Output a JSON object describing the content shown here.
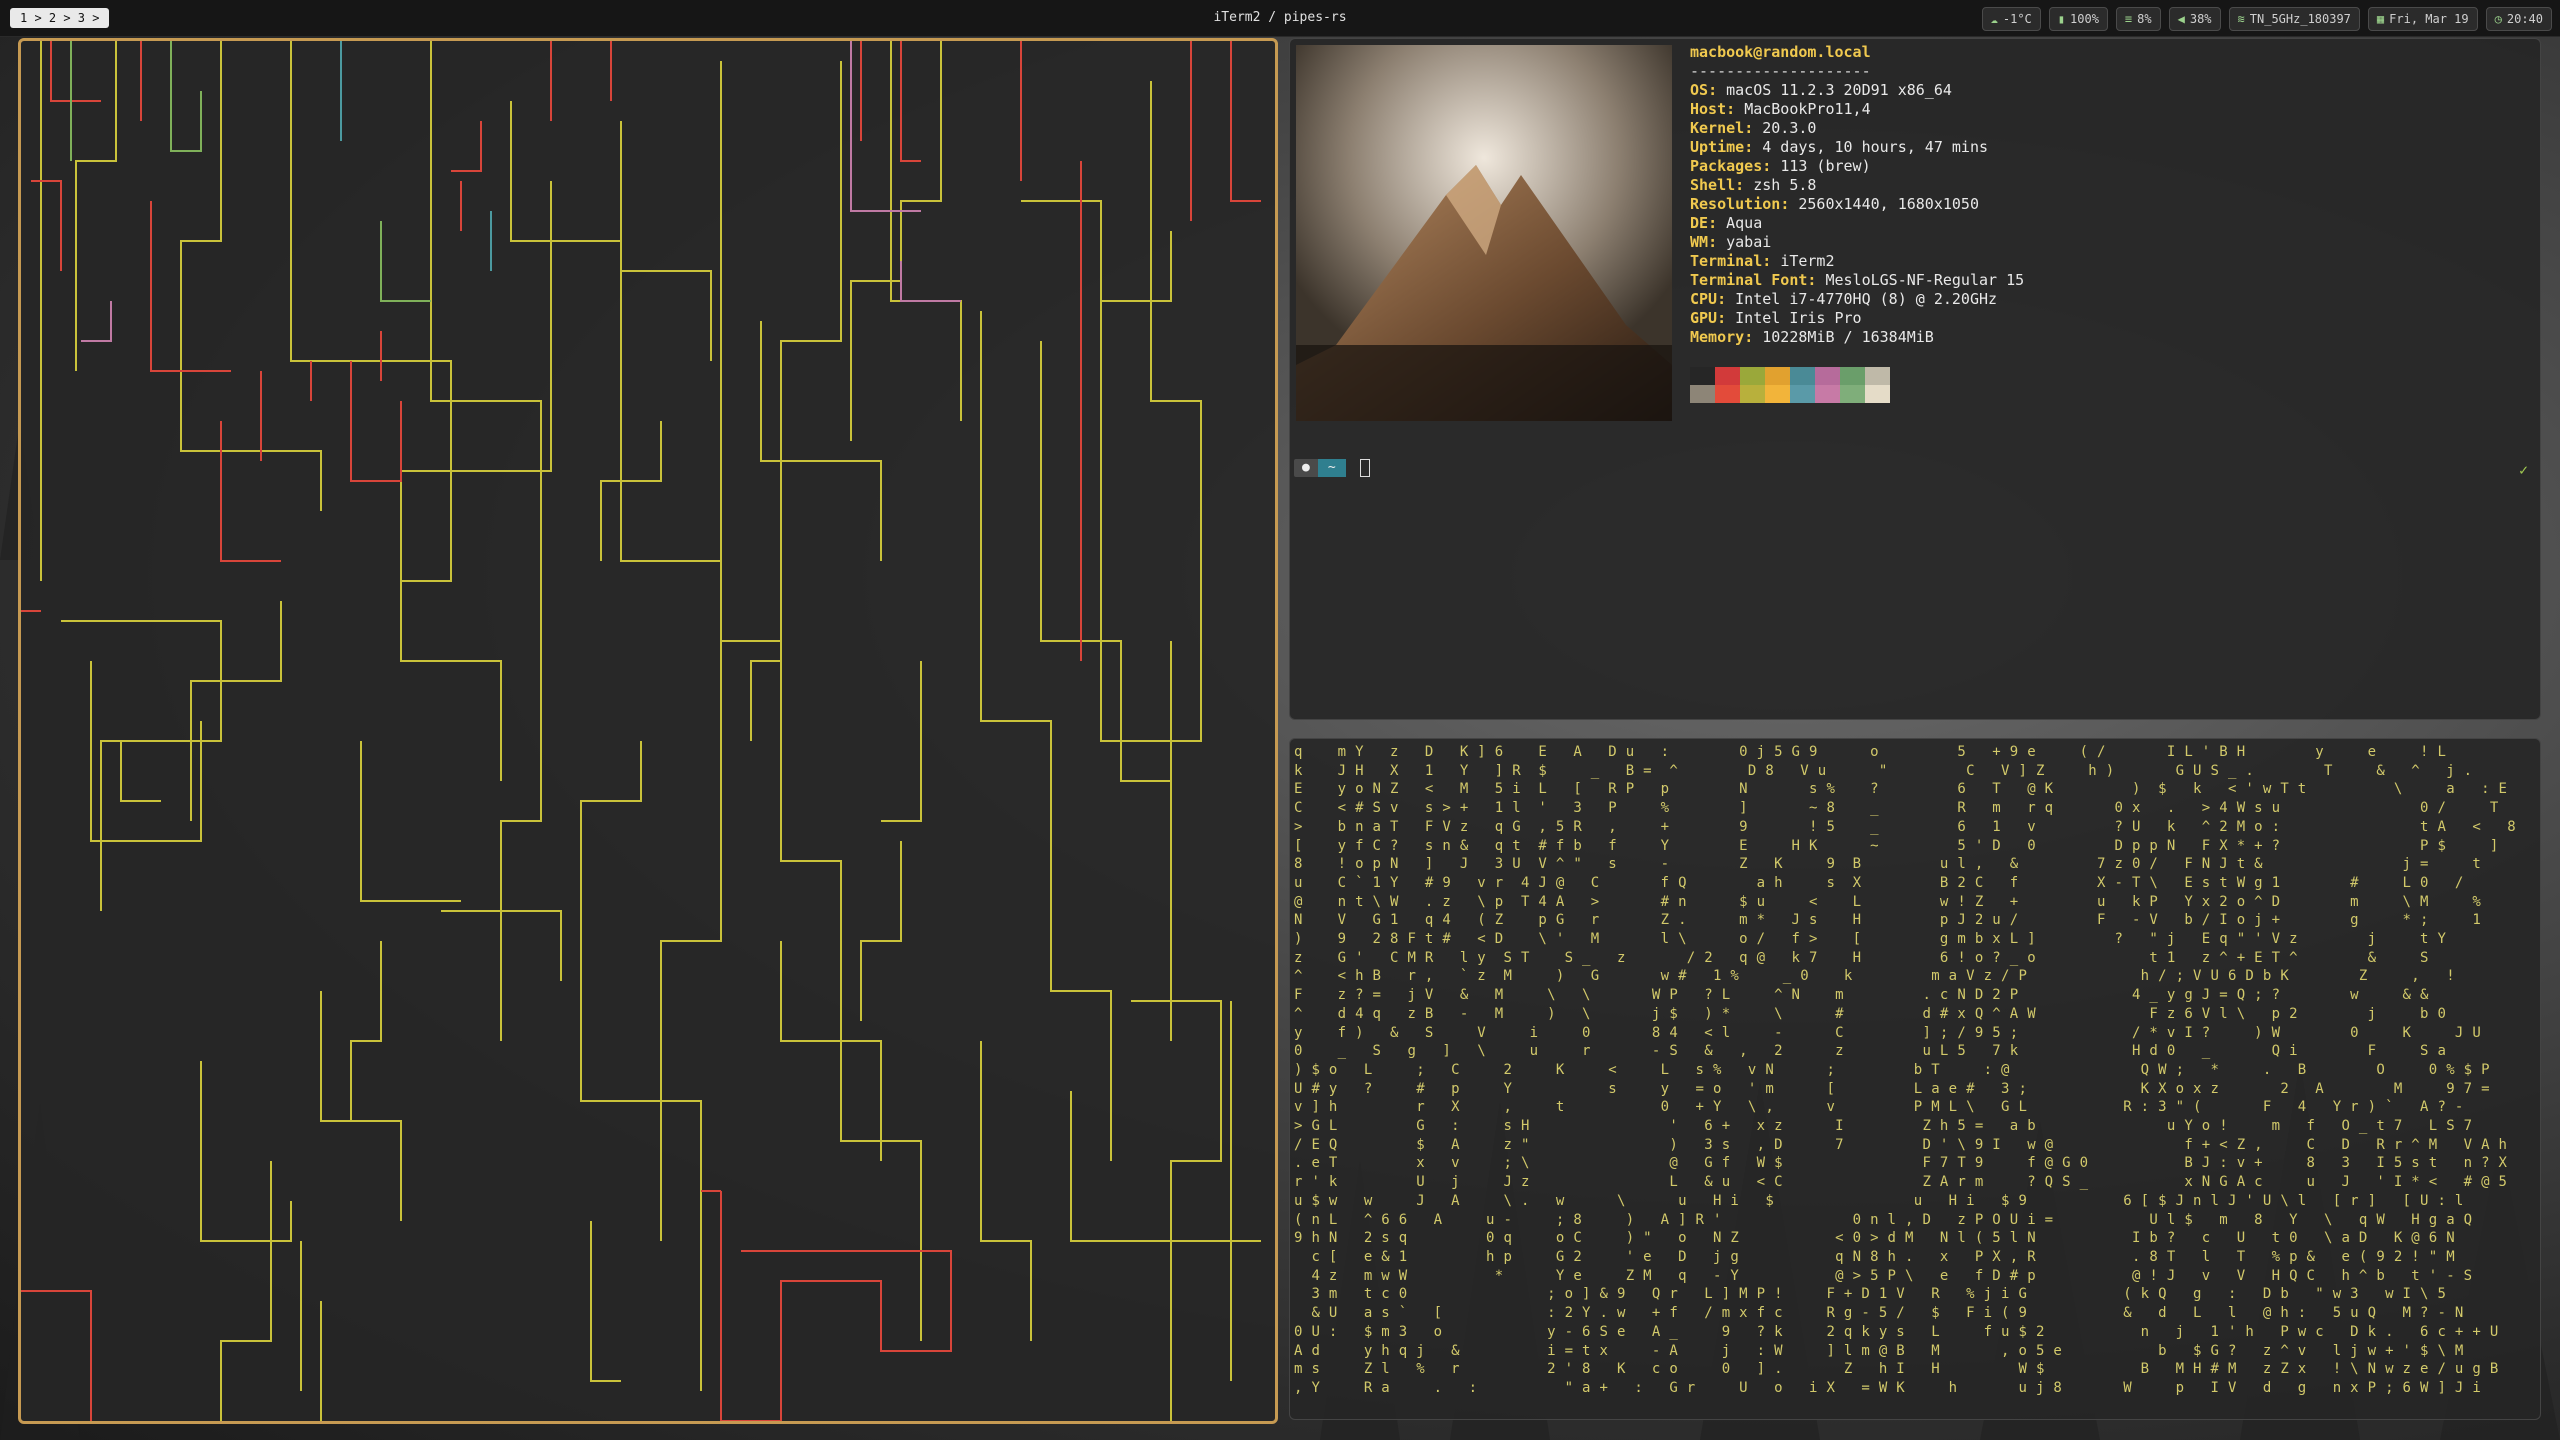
{
  "menubar": {
    "spaces_label": "1 > 2 > 3 >",
    "window_title": "iTerm2 / pipes-rs",
    "status": [
      {
        "icon": "cloud-icon",
        "label": "-1°C"
      },
      {
        "icon": "battery-icon",
        "label": "100%"
      },
      {
        "icon": "cpu-icon",
        "label": "8%"
      },
      {
        "icon": "volume-icon",
        "label": "38%"
      },
      {
        "icon": "wifi-icon",
        "label": "TN_5GHz_180397"
      },
      {
        "icon": "calendar-icon",
        "label": "Fri, Mar 19"
      },
      {
        "icon": "clock-icon",
        "label": "20:40"
      }
    ]
  },
  "neofetch": {
    "user_host": "macbook@random.local",
    "separator": "--------------------",
    "rows": [
      {
        "label": "OS",
        "value": "macOS 11.2.3 20D91 x86_64"
      },
      {
        "label": "Host",
        "value": "MacBookPro11,4"
      },
      {
        "label": "Kernel",
        "value": "20.3.0"
      },
      {
        "label": "Uptime",
        "value": "4 days, 10 hours, 47 mins"
      },
      {
        "label": "Packages",
        "value": "113 (brew)"
      },
      {
        "label": "Shell",
        "value": "zsh 5.8"
      },
      {
        "label": "Resolution",
        "value": "2560x1440, 1680x1050"
      },
      {
        "label": "DE",
        "value": "Aqua"
      },
      {
        "label": "WM",
        "value": "yabai"
      },
      {
        "label": "Terminal",
        "value": "iTerm2"
      },
      {
        "label": "Terminal Font",
        "value": "MesloLGS-NF-Regular 15"
      },
      {
        "label": "CPU",
        "value": "Intel i7-4770HQ (8) @ 2.20GHz"
      },
      {
        "label": "GPU",
        "value": "Intel Iris Pro"
      },
      {
        "label": "Memory",
        "value": "10228MiB / 16384MiB"
      }
    ],
    "palette_top": [
      "#262626",
      "#d23a3a",
      "#9aa83a",
      "#e1a12f",
      "#4a8a96",
      "#b66b9b",
      "#6a9e6a",
      "#bfb9a8"
    ],
    "palette_bottom": [
      "#8d8577",
      "#e34b3a",
      "#b8b03c",
      "#f2b43a",
      "#5a9aa8",
      "#c77aa6",
      "#7fae7a",
      "#e5dcc8"
    ]
  },
  "prompt": {
    "apple_segment": "",
    "dir_segment": "~",
    "status_check": "✓"
  },
  "matrix": {
    "lines": [
      "q    m Y   z   D   K ] 6    E   A   D u   :        0 j 5 G 9      o         5   + 9 e     ( /       I L ' B H        y     e     ! L",
      "k    J H   X   1   Y   ] R  $     _   B =  ^        D 8   V u      \"         C   V ] Z     h )       G U S _ .        T     &   ^   j .",
      "E    y o N Z   <   M   5 i  L   [   R P   p        N       s %    ?         6   T   @ K         )  $   k   < ' w T t          \\     a   : E",
      "C    < # S v   s > +   1 l  '   3   P     %        ]       ~ 8    _         R   m   r q       0 x   .   > 4 W s u                0 /     T",
      ">    b n a T   F V z   q G  , 5 R   ,     +        9       ! 5    _         6   1   v         ? U   k   ^ 2 M o :                t A   <   8",
      "[    y f C ?   s n &   q t  # f b   f     Y        E     H K      ~         5 ' D   0         D p p N   F X * + ?                P $     ]",
      "8    ! o p N   ]   J   3 U  V ^ \"   s     -        Z   K     9  B         u l ,   &         7 z 0 /   F N J t &                j =     t",
      "u    C ` 1 Y   # 9   v r  4 J @   C       f Q        a h     s  X         B 2 C   f         X - T \\   E s t W g 1        #     L 0   /",
      "@    n t \\ W   . z   \\ p  T 4 A   >       # n      $ u     <    L         w ! Z   +         u   k P   Y x 2 o ^ D        m     \\ M     %",
      "N    V   G 1   q 4   ( Z    p G   r       Z .      m *   J s    H         p J 2 u /         F   - V   b / I o j +        g     * ;     1",
      ")    9   2 8 F t #   < D    \\ '   M       l \\      o /   f >    [         g m b x L ]         ?   \" j   E q \" ' V z        j     t Y",
      "z    G '   C M R   l y  S T    S _   z       / 2   q @   k 7    H         6 ! o ? _ o             t 1   z ^ + E T ^        &     S",
      "^    < h B   r ,   ` z  M     )   G       w #   1 %     _ 0    k         m a V z / P             h / ; V U 6 D b K        Z     ,   !",
      "F    z ? =   j V   &   M     \\   \\       W P   ? L     ^ N    m         . c N D 2 P             4 _ y g J = Q ; ?        w     & &",
      "^    d 4 q   z B   -   M     )   \\       j $   ) *     \\      #         d # x Q ^ A W             F z 6 V l \\   p 2        j     b 0",
      "y    f )   &   S     V     i     0       8 4   < l     -      C         ] ; / 9 5 ;             / * v I ?     ) W        0     K     J U",
      "0    _   S   g   ]   \\     u     r       - S   &   ,   2      z         u L 5   7 k             H d 0   _       Q i        F     S a",
      ") $ o   L     ;   C     2     K     <     L   s %   v N      ;         b T     : @               Q W ;   *     .   B        O     0 % $ P",
      "U # y   ?     #   p     Y           s     y   = o   ' m      [         L a e #   3 ;             K X o x z       2   A        M     9 7 =",
      "v ] h         r   X     ,     t           0   + Y   \\ ,      v         P M L \\   G L           R : 3 \" (       F   4   Y r ) `   A ? -",
      "> G L         G   :     s H                '   6 +   x z      I         Z h 5 =   a b               u Y o !     m   f   O _ t 7   L S 7",
      "/ E Q         $   A     z \"                )   3 s   , D      7         D ' \\ 9 I   w @               f + < Z ,     C   D   R r ^ M   V A h",
      ". e T         x   v     ; \\                @   G f   W $                F 7 T 9     f @ G 0           B J : v +     8   3   I 5 s t   n ? X",
      "r ' k         U   j     J z                L   & u   < C                Z A r m     ? Q S _           x N G A c     u   J   ' I * <   # @ 5",
      "u $ w   w     J   A     \\ .   w      \\      u   H i   $                u   H i   $ 9           6 [ $ J n l J ' U \\ l   [ r ]   [ U : l",
      "( n L   ^ 6 6   A     u -     ; 8     )   A ] R '               0 n l , D   z P O U i =           U l $   m   8   Y   \\   q W   H g a Q",
      "9 h N   2 s q         0 q     o C     ) \"   o   N Z           < 0 > d M   N l ( 5 l N           I b ?   c   U   t 0   \\ a D   K @ 6 N",
      "  c [   e & 1         h p     G 2     ' e   D   j g           q N 8 h .   x   P X , R           . 8 T   l   T   % p &   e ( 9 2 ! \" M",
      "  4 z   m w W          *      Y e     Z M   q   - Y           @ > 5 P \\   e   f D # p           @ ! J   v   V   H Q C   h ^ b   t ' - S",
      "  3 m   t c 0                ; o ] & 9   Q r   L ] M P !     F + D 1 V   R   % j i G           ( k Q   g   :   D b   \" w 3   w I \\ 5",
      "  & U   a s `   [            : 2 Y . w   + f   / m x f c     R g - 5 /   $   F i ( 9           &   d   L   l   @ h :   5 u Q   M ? - N",
      "0 U :   $ m 3   o            y - 6 S e   A _     9   ? k     2 q k y s   L     f u $ 2           n   j   1 ' h   P w c   D k .   6 c + + U",
      "A d     y h q j   &          i = t x     - A     j   : W     ] l m @ B   M       , o 5 e           b   $ G ?   z ^ v   l j w + ' $ \\ M",
      "m s     Z l   %   r          2 ' 8   K   c o     0   ] .       Z   h I   H         W $           B   M H # M   z Z x   ! \\ N w z e / u g B",
      ", Y     R a     .   :          \" a +   :   G r     U   o   i X   = W K     h       u j 8       W     p   I V   d   g   n x P ; 6 W ] J i"
    ]
  }
}
